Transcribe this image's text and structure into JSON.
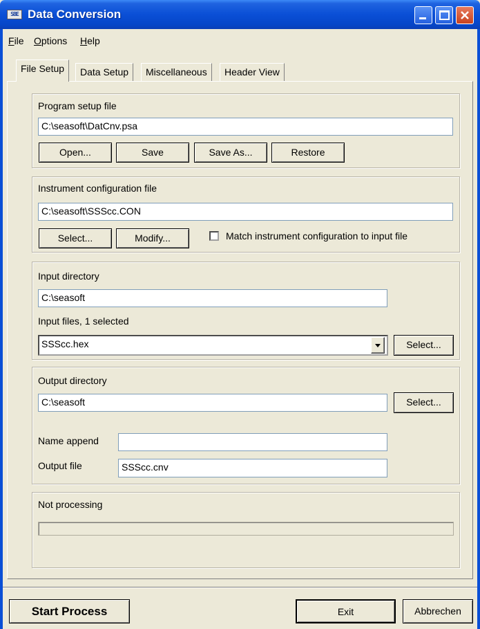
{
  "window": {
    "title": "Data Conversion",
    "icon_text": "SBE"
  },
  "menu": {
    "items": [
      "File",
      "Options",
      "Help"
    ]
  },
  "tabs": [
    {
      "label": "File Setup",
      "active": true
    },
    {
      "label": "Data Setup",
      "active": false
    },
    {
      "label": "Miscellaneous",
      "active": false
    },
    {
      "label": "Header View",
      "active": false
    }
  ],
  "program_setup": {
    "label": "Program setup file",
    "value": "C:\\seasoft\\DatCnv.psa",
    "buttons": {
      "open": "Open...",
      "save": "Save",
      "save_as": "Save As...",
      "restore": "Restore"
    }
  },
  "instrument": {
    "label": "Instrument configuration file",
    "value": "C:\\seasoft\\SSScc.CON",
    "select": "Select...",
    "modify": "Modify...",
    "match_label": "Match instrument configuration to input file",
    "match_checked": false
  },
  "input": {
    "dir_label": "Input directory",
    "dir_value": "C:\\seasoft",
    "files_label": "Input files, 1 selected",
    "files_value": "SSScc.hex",
    "select": "Select..."
  },
  "output": {
    "dir_label": "Output directory",
    "dir_value": "C:\\seasoft",
    "select": "Select...",
    "name_append_label": "Name append",
    "name_append_value": "",
    "output_file_label": "Output file",
    "output_file_value": "SSScc.cnv"
  },
  "status": {
    "text": "Not processing",
    "progress": 0
  },
  "footer": {
    "start": "Start Process",
    "exit": "Exit",
    "cancel": "Abbrechen"
  },
  "colors": {
    "titlebar": "#0a4fd6",
    "window_bg": "#ece9d8",
    "close_button": "#c9431f"
  }
}
